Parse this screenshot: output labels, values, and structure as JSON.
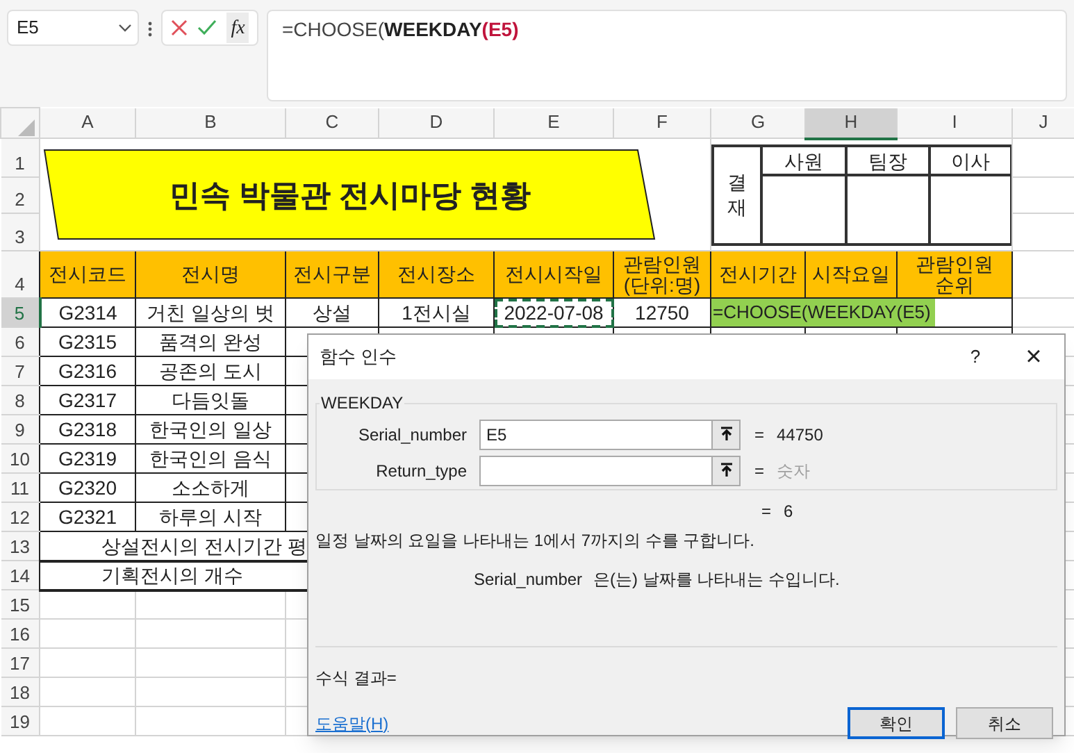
{
  "name_box": {
    "value": "E5"
  },
  "formula_buttons": {
    "function": "fx"
  },
  "formula": [
    {
      "text": "=CHOOSE(",
      "bold": false
    },
    {
      "text": "WEEKDAY",
      "bold": true
    },
    {
      "text": "(E5)",
      "bold": true,
      "color": "#c0143c"
    }
  ],
  "columns": [
    {
      "label": "A",
      "selected": false
    },
    {
      "label": "B",
      "selected": false
    },
    {
      "label": "C",
      "selected": false
    },
    {
      "label": "D",
      "selected": false
    },
    {
      "label": "E",
      "selected": false
    },
    {
      "label": "F",
      "selected": false
    },
    {
      "label": "G",
      "selected": false
    },
    {
      "label": "H",
      "selected": true
    },
    {
      "label": "I",
      "selected": false
    },
    {
      "label": "J",
      "selected": false
    }
  ],
  "title_banner": "민속 박물관 전시마당 현황",
  "approval": {
    "label": "결재",
    "columns": [
      "사원",
      "팀장",
      "이사"
    ]
  },
  "rows": [
    {
      "number": "1",
      "selected": false
    },
    {
      "number": "2",
      "selected": false
    },
    {
      "number": "3",
      "selected": false
    },
    {
      "number": "4",
      "selected": false,
      "cells": [
        {
          "text": "전시코드",
          "kind": "header"
        },
        {
          "text": "전시명",
          "kind": "header"
        },
        {
          "text": "전시구분",
          "kind": "header"
        },
        {
          "text": "전시장소",
          "kind": "header"
        },
        {
          "text": "전시시작일",
          "kind": "header"
        },
        {
          "text": "관람인원\n(단위:명)",
          "kind": "header"
        },
        {
          "text": "전시기간",
          "kind": "header"
        },
        {
          "text": "시작요일",
          "kind": "header"
        },
        {
          "text": "관람인원\n순위",
          "kind": "header"
        }
      ]
    },
    {
      "number": "5",
      "selected": true,
      "cells": [
        {
          "text": "G2314",
          "kind": "data"
        },
        {
          "text": "거친 일상의 벗",
          "kind": "data"
        },
        {
          "text": "상설",
          "kind": "data"
        },
        {
          "text": "1전시실",
          "kind": "data"
        },
        {
          "text": "2022-07-08",
          "kind": "referenced"
        },
        {
          "text": "12750",
          "kind": "data"
        },
        {
          "text": "=CHOOSE(WEEKDAY(E5)",
          "kind": "editing"
        }
      ]
    },
    {
      "number": "6",
      "selected": false,
      "cells": [
        {
          "text": "G2315",
          "kind": "data"
        },
        {
          "text": "품격의 완성",
          "kind": "data"
        }
      ]
    },
    {
      "number": "7",
      "selected": false,
      "cells": [
        {
          "text": "G2316",
          "kind": "data"
        },
        {
          "text": "공존의 도시",
          "kind": "data"
        }
      ]
    },
    {
      "number": "8",
      "selected": false,
      "cells": [
        {
          "text": "G2317",
          "kind": "data"
        },
        {
          "text": "다듬잇돌",
          "kind": "data"
        }
      ]
    },
    {
      "number": "9",
      "selected": false,
      "cells": [
        {
          "text": "G2318",
          "kind": "data"
        },
        {
          "text": "한국인의 일상",
          "kind": "data"
        }
      ]
    },
    {
      "number": "10",
      "selected": false,
      "cells": [
        {
          "text": "G2319",
          "kind": "data"
        },
        {
          "text": "한국인의 음식",
          "kind": "data"
        }
      ]
    },
    {
      "number": "11",
      "selected": false,
      "cells": [
        {
          "text": "G2320",
          "kind": "data"
        },
        {
          "text": "소소하게",
          "kind": "data"
        }
      ]
    },
    {
      "number": "12",
      "selected": false,
      "cells": [
        {
          "text": "G2321",
          "kind": "data"
        },
        {
          "text": "하루의 시작",
          "kind": "data"
        }
      ]
    },
    {
      "number": "13",
      "selected": false,
      "cells": [
        {
          "text": "상설전시의 전시기간 평",
          "kind": "label"
        }
      ]
    },
    {
      "number": "14",
      "selected": false,
      "cells": [
        {
          "text": "기획전시의 개수",
          "kind": "label"
        }
      ]
    },
    {
      "number": "15",
      "selected": false
    },
    {
      "number": "16",
      "selected": false
    },
    {
      "number": "17",
      "selected": false
    },
    {
      "number": "18",
      "selected": false
    },
    {
      "number": "19",
      "selected": false
    }
  ],
  "dialog": {
    "title": "함수 인수",
    "help": "?",
    "close": "×",
    "function_name": "WEEKDAY",
    "arguments": [
      {
        "label": "Serial_number",
        "value": "E5",
        "equals": "=",
        "result": "44750",
        "muted": false
      },
      {
        "label": "Return_type",
        "equals": "=",
        "result": "숫자",
        "muted": true
      }
    ],
    "result_equals": "=",
    "result": "6",
    "description": "일정 날짜의 요일을 나타내는 1에서 7까지의 수를 구합니다.",
    "argument_name": "Serial_number",
    "argument_help": "은(는) 날짜를 나타내는 수입니다.",
    "formula_result": "수식 결과=",
    "help_link": "도움말(H)",
    "buttons": [
      {
        "label": "확인",
        "default": true
      },
      {
        "label": "취소",
        "default": false
      }
    ]
  }
}
